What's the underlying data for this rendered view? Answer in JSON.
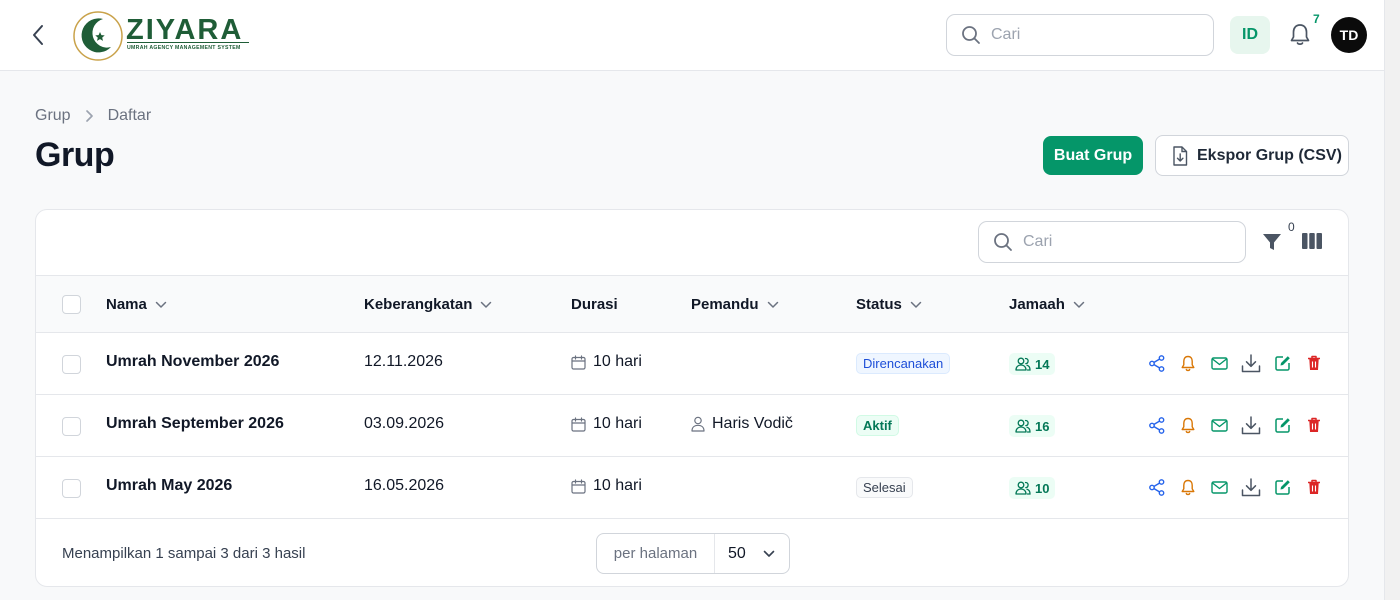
{
  "app": {
    "logo_text": "ZIYARA",
    "logo_subtitle": "UMRAH AGENCY MANAGEMENT SYSTEM"
  },
  "header": {
    "search_placeholder": "Cari",
    "language": "ID",
    "notifications_count": "7",
    "avatar_initials": "TD"
  },
  "breadcrumb": {
    "items": [
      "Grup",
      "Daftar"
    ]
  },
  "page": {
    "title": "Grup",
    "create_button": "Buat Grup",
    "export_button": "Ekspor Grup (CSV)"
  },
  "table": {
    "search_placeholder": "Cari",
    "filter_count": "0",
    "columns": [
      "Nama",
      "Keberangkatan",
      "Durasi",
      "Pemandu",
      "Status",
      "Jamaah"
    ],
    "rows": [
      {
        "name": "Umrah November 2026",
        "departure": "12.11.2026",
        "duration": "10 hari",
        "guide": "",
        "status": "Direncanakan",
        "pilgrims": "14"
      },
      {
        "name": "Umrah September 2026",
        "departure": "03.09.2026",
        "duration": "10 hari",
        "guide": "Haris Vodič",
        "status": "Aktif",
        "pilgrims": "16"
      },
      {
        "name": "Umrah May 2026",
        "departure": "16.05.2026",
        "duration": "10 hari",
        "guide": "",
        "status": "Selesai",
        "pilgrims": "10"
      }
    ],
    "footer_text": "Menampilkan 1 sampai 3 dari 3 hasil",
    "per_page_label": "per halaman",
    "per_page_value": "50"
  },
  "colors": {
    "brand_green": "#059669",
    "logo_green": "#1f5d37",
    "share": "#2563eb",
    "bell": "#d97706",
    "mail": "#059669",
    "download": "#4b5563",
    "edit": "#059669",
    "delete": "#dc2626"
  },
  "icons": [
    "chevron-left-icon",
    "search-icon",
    "bell-icon",
    "file-download-icon",
    "filter-icon",
    "columns-icon",
    "chevron-down-icon",
    "chevron-right-icon",
    "calendar-icon",
    "user-icon",
    "users-icon",
    "share-icon",
    "mail-icon",
    "download-icon",
    "edit-icon",
    "trash-icon"
  ]
}
